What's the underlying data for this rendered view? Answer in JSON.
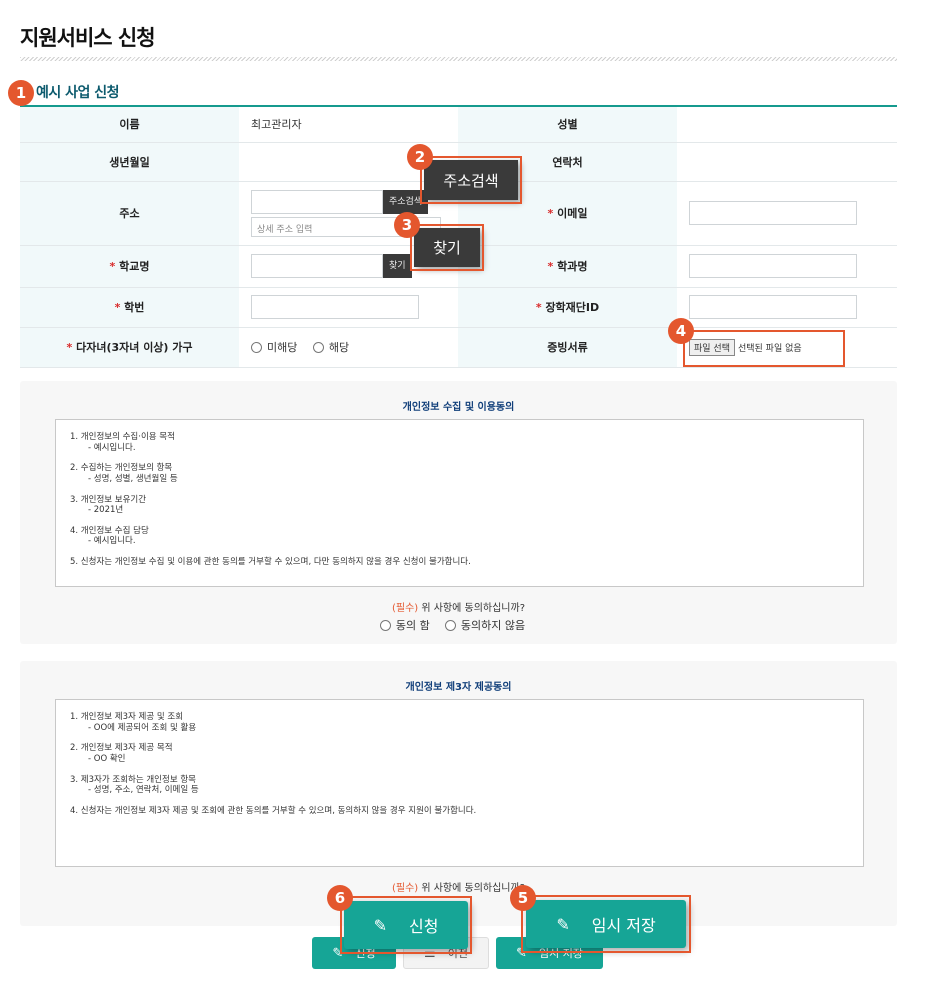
{
  "page": {
    "title": "지원서비스 신청"
  },
  "section": {
    "title": "예시 사업 신청"
  },
  "form": {
    "name_label": "이름",
    "name_value": "최고관리자",
    "gender_label": "성별",
    "birth_label": "생년월일",
    "contact_label": "연락처",
    "address_label": "주소",
    "address_search_btn": "주소검색",
    "address_detail_placeholder": "상세 주소 입력",
    "email_label": "이메일",
    "school_label": "학교명",
    "find_btn": "찾기",
    "major_label": "학과명",
    "student_id_label": "학번",
    "scholarship_id_label": "장학재단ID",
    "multichild_label": "다자녀(3자녀 이상) 가구",
    "multichild_options": [
      "미해당",
      "해당"
    ],
    "proof_label": "증빙서류",
    "file_btn": "파일 선택",
    "file_status": "선택된 파일 없음",
    "required_mark": "*"
  },
  "consent1": {
    "title": "개인정보 수집 및 이용동의",
    "items": [
      {
        "head": "1. 개인정보의 수집·이용 목적",
        "sub": "- 예시입니다."
      },
      {
        "head": "2. 수집하는 개인정보의 항목",
        "sub": "- 성명, 성별, 생년월일 등"
      },
      {
        "head": "3. 개인정보 보유기간",
        "sub": "- 2021년"
      },
      {
        "head": "4. 개인정보 수집 담당",
        "sub": "- 예시입니다."
      },
      {
        "head": "5. 신청자는 개인정보 수집 및 이용에 관한 동의를 거부할 수 있으며, 다만 동의하지 않을 경우 신청이 불가합니다.",
        "sub": ""
      }
    ],
    "must": "(필수)",
    "question": " 위 사항에 동의하십니까?",
    "options": [
      "동의 함",
      "동의하지 않음"
    ]
  },
  "consent2": {
    "title": "개인정보 제3자 제공동의",
    "items": [
      {
        "head": "1. 개인정보 제3자 제공 및 조회",
        "sub": "- OO에 제공되어 조회 및 활용"
      },
      {
        "head": "2. 개인정보 제3자 제공 목적",
        "sub": "- OO 확인"
      },
      {
        "head": "3. 제3자가 조회하는 개인정보 항목",
        "sub": "- 성명, 주소, 연락처, 이메일 등"
      },
      {
        "head": "4. 신청자는 개인정보 제3자 제공 및 조회에 관한 동의를 거부할 수 있으며, 동의하지 않을 경우 지원이 불가합니다.",
        "sub": ""
      }
    ],
    "must": "(필수)",
    "question": " 위 사항에 동의하십니까?"
  },
  "buttons": {
    "apply": "신청",
    "prev": "이전",
    "temp_save": "임시 저장"
  },
  "callouts": {
    "n1": "1",
    "n2": "2",
    "n3": "3",
    "n4": "4",
    "n5": "5",
    "n6": "6"
  },
  "icons": {
    "pencil": "pencil-icon",
    "list": "list-icon"
  },
  "colors": {
    "teal": "#16a596",
    "callout": "#e4572e",
    "section": "#0d5b6e"
  }
}
